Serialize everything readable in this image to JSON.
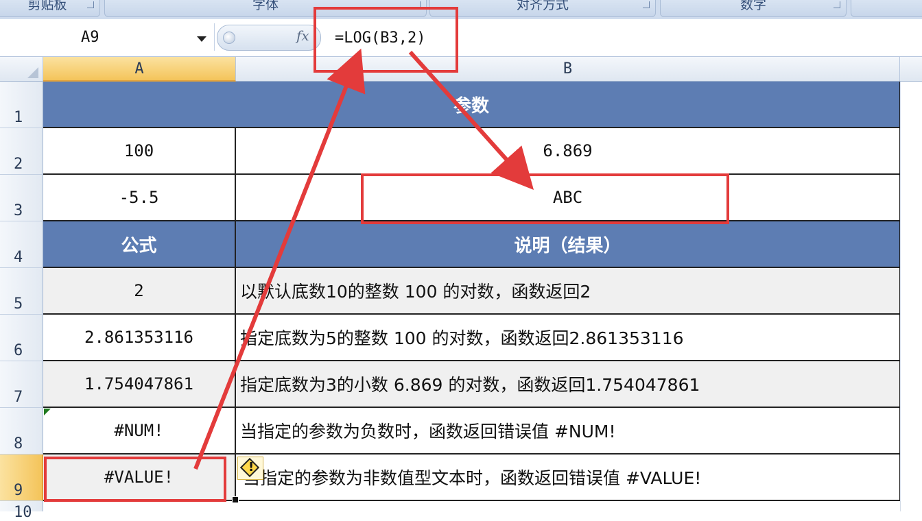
{
  "ribbon": {
    "groups": [
      "剪贴板",
      "字体",
      "对齐方式",
      "数字"
    ]
  },
  "formula_bar": {
    "name_box": "A9",
    "fx_label": "fx",
    "formula": "=LOG(B3,2)"
  },
  "columns": [
    "A",
    "B"
  ],
  "rows": [
    "1",
    "2",
    "3",
    "4",
    "5",
    "6",
    "7",
    "8",
    "9",
    "10"
  ],
  "sheet": {
    "header1": "参数",
    "a2": "100",
    "b2": "6.869",
    "a3": "-5.5",
    "b3": "ABC",
    "header_a4": "公式",
    "header_b4": "说明（结果）",
    "a5": "2",
    "b5": "以默认底数10的整数 100 的对数，函数返回2",
    "a6": "2.861353116",
    "b6": "指定底数为5的整数 100 的对数，函数返回2.861353116",
    "a7": "1.754047861",
    "b7": "指定底数为3的小数 6.869 的对数，函数返回1.754047861",
    "a8": "#NUM!",
    "b8": "当指定的参数为负数时，函数返回错误值 #NUM!",
    "a9": "#VALUE!",
    "b9": "当指定的参数为非数值型文本时，函数返回错误值 #VALUE!"
  },
  "colors": {
    "header_fill": "#5d7db3",
    "annotation": "#e33b3b",
    "selected_header": "#f4c45a"
  }
}
